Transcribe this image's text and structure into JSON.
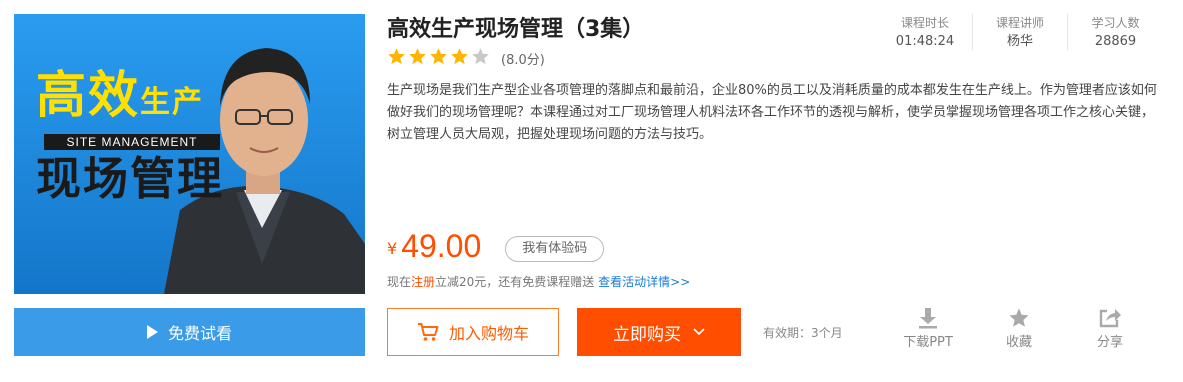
{
  "cover": {
    "title_line1_big": "高效",
    "title_line1_small": "生产",
    "subtitle_en": "SITE MANAGEMENT",
    "title_line2": "现场管理",
    "background_color": "#1e8fe6",
    "title_yellow": "#ffe000"
  },
  "course": {
    "title": "高效生产现场管理（3集）",
    "rating_stars": 4,
    "rating_max": 5,
    "score_text": "(8.0分)",
    "description": "生产现场是我们生产型企业各项管理的落脚点和最前沿，企业80%的员工以及消耗质量的成本都发生在生产线上。作为管理者应该如何做好我们的现场管理呢？本课程通过对工厂现场管理人机料法环各工作环节的透视与解析，使学员掌握现场管理各项工作之核心关键，树立管理人员大局观，把握处理现场问题的方法与技巧。"
  },
  "stats": [
    {
      "label": "课程时长",
      "value": "01:48:24"
    },
    {
      "label": "课程讲师",
      "value": "杨华"
    },
    {
      "label": "学习人数",
      "value": "28869"
    }
  ],
  "price": {
    "symbol": "¥",
    "amount": "49.00",
    "trial_code_label": "我有体验码",
    "accent_color": "#ff4e00"
  },
  "promo": {
    "prefix": "现在",
    "register": "注册",
    "middle": "立减20元，还有免费课程赠送",
    "link": "查看活动详情>>"
  },
  "buttons": {
    "free_watch": "免费试看",
    "add_cart": "加入购物车",
    "buy_now": "立即购买"
  },
  "validity": "有效期：3个月",
  "actions": [
    {
      "label": "下载PPT",
      "icon": "download-icon"
    },
    {
      "label": "收藏",
      "icon": "star-icon"
    },
    {
      "label": "分享",
      "icon": "share-icon"
    }
  ]
}
